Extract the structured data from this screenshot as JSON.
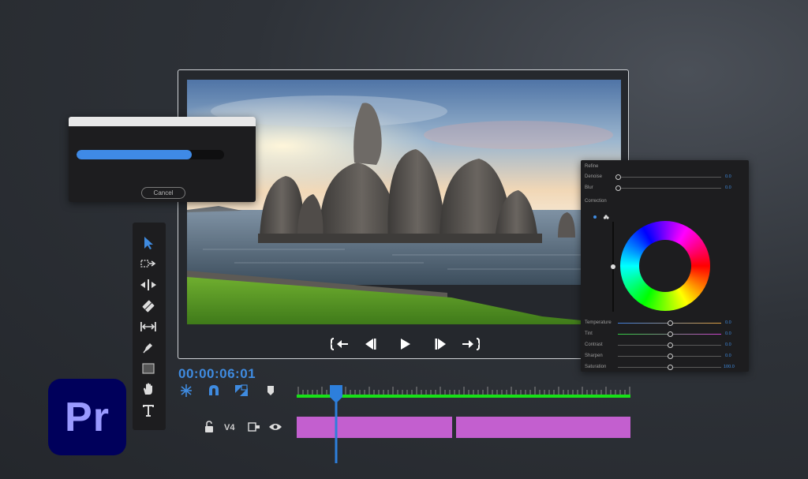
{
  "app": {
    "logo_text": "Pr"
  },
  "progress_dialog": {
    "cancel_label": "Cancel",
    "progress": 0.78
  },
  "tools": [
    {
      "name": "selection-tool",
      "icon": "arrow-icon",
      "active": true
    },
    {
      "name": "track-select-tool",
      "icon": "track-select-icon"
    },
    {
      "name": "ripple-edit-tool",
      "icon": "ripple-edit-icon"
    },
    {
      "name": "razor-tool",
      "icon": "razor-icon"
    },
    {
      "name": "slip-tool",
      "icon": "slip-icon"
    },
    {
      "name": "pen-tool",
      "icon": "pen-icon"
    },
    {
      "name": "rectangle-tool",
      "icon": "rectangle-icon"
    },
    {
      "name": "hand-tool",
      "icon": "hand-icon"
    },
    {
      "name": "type-tool",
      "icon": "type-icon"
    }
  ],
  "program_monitor": {
    "transport": [
      "go-to-in-icon",
      "step-back-icon",
      "play-icon",
      "step-forward-icon",
      "go-to-out-icon"
    ]
  },
  "timeline": {
    "timecode": "00:00:06:01",
    "track_label": "V4",
    "playhead_position": 0.12,
    "icons": [
      "snap-icon",
      "magnet-icon",
      "linked-selection-icon",
      "marker-icon",
      "lock-icon",
      "toggle-sync-icon",
      "eye-icon"
    ]
  },
  "color_panel": {
    "section1": "Refine",
    "refine": [
      {
        "label": "Denoise",
        "value": "0.0",
        "level": 0
      },
      {
        "label": "Blur",
        "value": "0.0",
        "level": 0
      }
    ],
    "section2": "Correction",
    "adjust": [
      {
        "label": "Temperature",
        "value": "0.0",
        "level": 0.5
      },
      {
        "label": "Tint",
        "value": "0.0",
        "level": 0.5
      },
      {
        "label": "Contrast",
        "value": "0.0",
        "level": 0.5
      },
      {
        "label": "Sharpen",
        "value": "0.0",
        "level": 0.5
      },
      {
        "label": "Saturation",
        "value": "100.0",
        "level": 0.5
      }
    ]
  },
  "colors": {
    "accent": "#3f8be0",
    "clip": "#c35fcf",
    "timeline_bar": "#18e018",
    "logo_bg": "#00005b",
    "logo_text": "#9999ff"
  }
}
